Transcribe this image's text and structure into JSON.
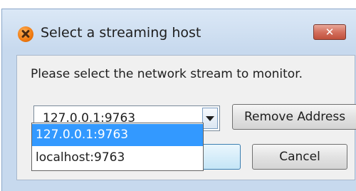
{
  "window": {
    "title": "Select a streaming host",
    "close_label": "✕"
  },
  "prompt": "Please select the network stream to monitor.",
  "combo": {
    "selected": "127.0.0.1:9763",
    "options": [
      "127.0.0.1:9763",
      "localhost:9763"
    ],
    "highlighted_index": 0
  },
  "buttons": {
    "remove_label": "Remove Address",
    "ok_label": "",
    "cancel_label": "Cancel"
  },
  "colors": {
    "selection": "#3399ff",
    "frame": "#c7d9ee",
    "close": "#d4705e"
  }
}
